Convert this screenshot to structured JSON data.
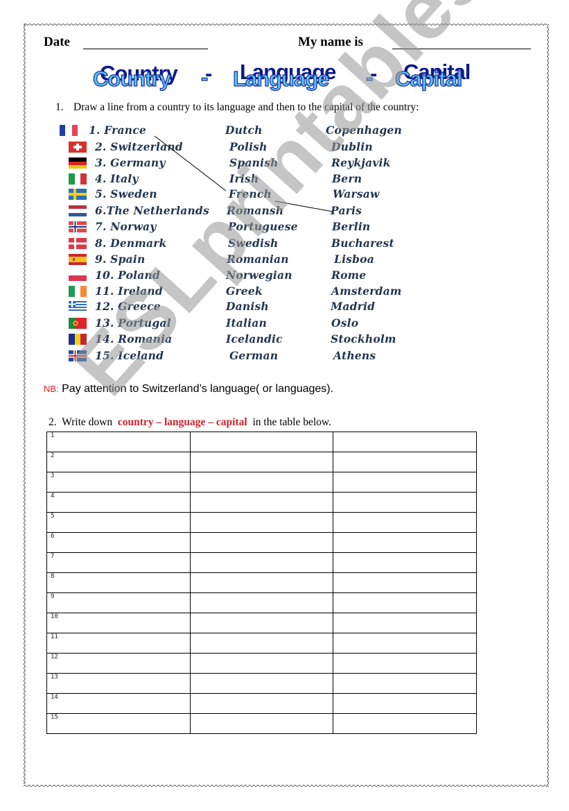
{
  "header": {
    "date_label": "Date",
    "name_label": "My name is"
  },
  "title": {
    "word1": "Country",
    "sep1": "-",
    "word2": "Language",
    "sep2": "-",
    "word3": "Capital"
  },
  "exercise1": {
    "number": "1.",
    "instruction": "Draw a line from a country to its language and then to the capital of the country:",
    "rows": [
      {
        "country": "1. France",
        "language": "Dutch",
        "capital": "Copenhagen",
        "flag": "france-flag-icon"
      },
      {
        "country": "2. Switzerland",
        "language": "Polish",
        "capital": "Dublin",
        "flag": "switzerland-flag-icon"
      },
      {
        "country": "3. Germany",
        "language": "Spanish",
        "capital": "Reykjavik",
        "flag": "germany-flag-icon"
      },
      {
        "country": "4. Italy",
        "language": "Irish",
        "capital": "Bern",
        "flag": "italy-flag-icon"
      },
      {
        "country": "5. Sweden",
        "language": "French",
        "capital": "Warsaw",
        "flag": "sweden-flag-icon"
      },
      {
        "country": "6.The Netherlands",
        "language": "Romansh",
        "capital": "Paris",
        "flag": "netherlands-flag-icon"
      },
      {
        "country": "7. Norway",
        "language": "Portuguese",
        "capital": "Berlin",
        "flag": "norway-flag-icon"
      },
      {
        "country": "8. Denmark",
        "language": "Swedish",
        "capital": "Bucharest",
        "flag": "denmark-flag-icon"
      },
      {
        "country": "9. Spain",
        "language": "Romanian",
        "capital": "Lisboa",
        "flag": "spain-flag-icon"
      },
      {
        "country": "10. Poland",
        "language": "Norwegian",
        "capital": "Rome",
        "flag": "poland-flag-icon"
      },
      {
        "country": "11. Ireland",
        "language": "Greek",
        "capital": "Amsterdam",
        "flag": "ireland-flag-icon"
      },
      {
        "country": "12. Greece",
        "language": "Danish",
        "capital": "Madrid",
        "flag": "greece-flag-icon"
      },
      {
        "country": "13. Portugal",
        "language": "Italian",
        "capital": "Oslo",
        "flag": "portugal-flag-icon"
      },
      {
        "country": "14. Romania",
        "language": "Icelandic",
        "capital": "Stockholm",
        "flag": "romania-flag-icon"
      },
      {
        "country": "15. Iceland",
        "language": "German",
        "capital": "Athens",
        "flag": "iceland-flag-icon"
      }
    ],
    "example_connection": {
      "country": "1. France",
      "language": "French",
      "capital": "Paris"
    }
  },
  "note": {
    "label": "NB:",
    "text": "Pay attention to Switzerland’s  language( or languages)."
  },
  "exercise2": {
    "number": "2.",
    "prefix": "Write down",
    "highlight": "country – language – capital",
    "suffix": "in the table below.",
    "row_numbers": [
      "1",
      "2",
      "3",
      "4",
      "5",
      "6",
      "7",
      "8",
      "9",
      "10",
      "11",
      "12",
      "13",
      "14",
      "15"
    ]
  },
  "watermark": "ESLprintables.com",
  "colors": {
    "list_text": "#1f3550",
    "highlight_red": "#c9252c",
    "nb_red": "#e0201c",
    "wordart_front": "#5ec1f5",
    "wordart_shadow": "#0a1a8c"
  }
}
